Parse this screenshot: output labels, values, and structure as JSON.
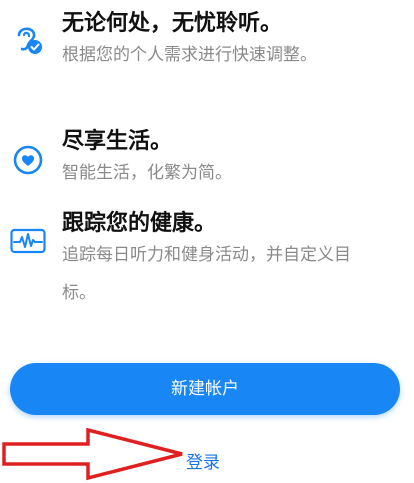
{
  "features": [
    {
      "icon": "ear-check-icon",
      "title": "无论何处，无忧聆听。",
      "description": "根据您的个人需求进行快速调整。"
    },
    {
      "icon": "heart-circle-icon",
      "title": "尽享生活。",
      "description": "智能生活，化繁为简。"
    },
    {
      "icon": "heartbeat-monitor-icon",
      "title": "跟踪您的健康。",
      "description": "追踪每日听力和健身活动，并自定义目标。"
    }
  ],
  "actions": {
    "create_account_label": "新建帐户",
    "login_label": "登录"
  },
  "colors": {
    "accent": "#1886f5",
    "link": "#1a73e8",
    "annotation_arrow": "#e02020"
  }
}
